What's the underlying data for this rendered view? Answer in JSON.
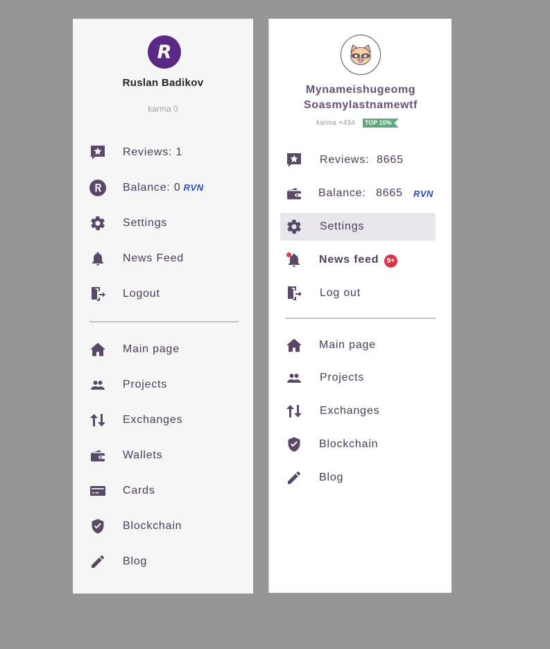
{
  "panel_a": {
    "avatar_letter": "R",
    "user_name": "Ruslan Badikov",
    "karma": "karma 0",
    "menu": {
      "reviews": "Reviews: 1",
      "balance": "Balance: 0",
      "balance_currency": "RVN",
      "settings": "Settings",
      "news_feed": "News Feed",
      "logout": "Logout"
    },
    "nav": {
      "main_page": "Main page",
      "projects": "Projects",
      "exchanges": "Exchanges",
      "wallets": "Wallets",
      "cards": "Cards",
      "blockchain": "Blockchain",
      "blog": "Blog"
    }
  },
  "panel_b": {
    "user_name_line1": "Mynameishugeomg",
    "user_name_line2": "Soasmylastnamewtf",
    "karma": "karma +434",
    "top_badge": "TOP 10%",
    "menu": {
      "reviews_label": "Reviews:",
      "reviews_value": "8665",
      "balance_label": "Balance:",
      "balance_value": "8665",
      "balance_currency": "RVN",
      "settings": "Settings",
      "news_feed": "News feed",
      "news_badge": "9+",
      "logout": "Log out"
    },
    "nav": {
      "main_page": "Main page",
      "projects": "Projects",
      "exchanges": "Exchanges",
      "blockchain": "Blockchain",
      "blog": "Blog"
    }
  },
  "colors": {
    "background": "#959595",
    "icon": "#5b4868",
    "avatar_purple": "#5a2a86",
    "rvn_blue": "#2a4cb8",
    "top_badge_green": "#5fa87d",
    "notification_red": "#d8344a",
    "active_row": "#e8e6eb"
  },
  "icons": [
    "star-review-icon",
    "ravencoin-logo-icon",
    "wallet-icon",
    "gear-icon",
    "bell-icon",
    "logout-door-icon",
    "home-icon",
    "people-icon",
    "exchange-arrows-icon",
    "card-icon",
    "shield-check-icon",
    "pencil-icon",
    "raccoon-avatar-icon"
  ]
}
